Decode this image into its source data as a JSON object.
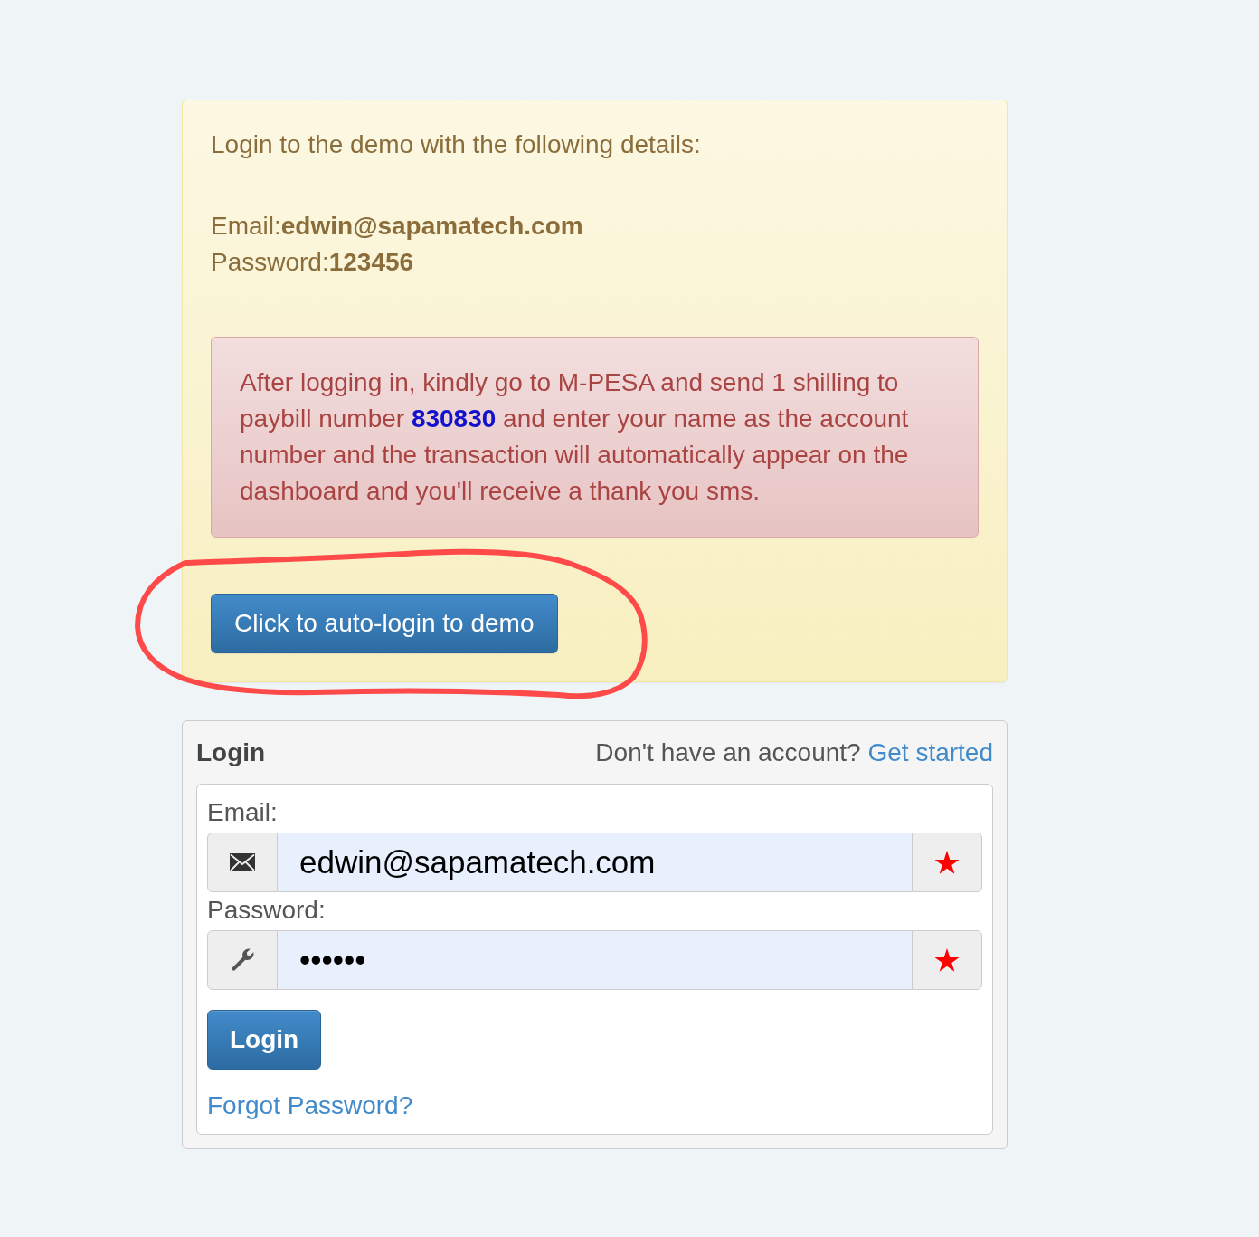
{
  "demo_notice": {
    "intro": "Login to the demo with the following details:",
    "credential_lines": [
      "Email:**edwin@sapamatech.com**",
      "Password:**123456**"
    ]
  },
  "alert": {
    "text": "After logging in, kindly go to M-PESA and send 1 shilling to paybill number **830830** and enter your name as the account number and the transaction will automatically appear on the dashboard and you'll receive a thank you sms."
  },
  "auto_login_button": {
    "label": "Click to auto-login to demo",
    "circled": true
  },
  "login_panel": {
    "title": "Login",
    "signup_prompt": "Don't have an account?",
    "signup_link": "Get started",
    "fields": [
      {
        "label": "Email:",
        "kind": "email",
        "value": "edwin@sapamatech.com",
        "required": true
      },
      {
        "label": "Password:",
        "kind": "password",
        "value": "••••••",
        "required": true
      }
    ],
    "submit": "Login",
    "forgot_link": "Forgot Password?"
  }
}
